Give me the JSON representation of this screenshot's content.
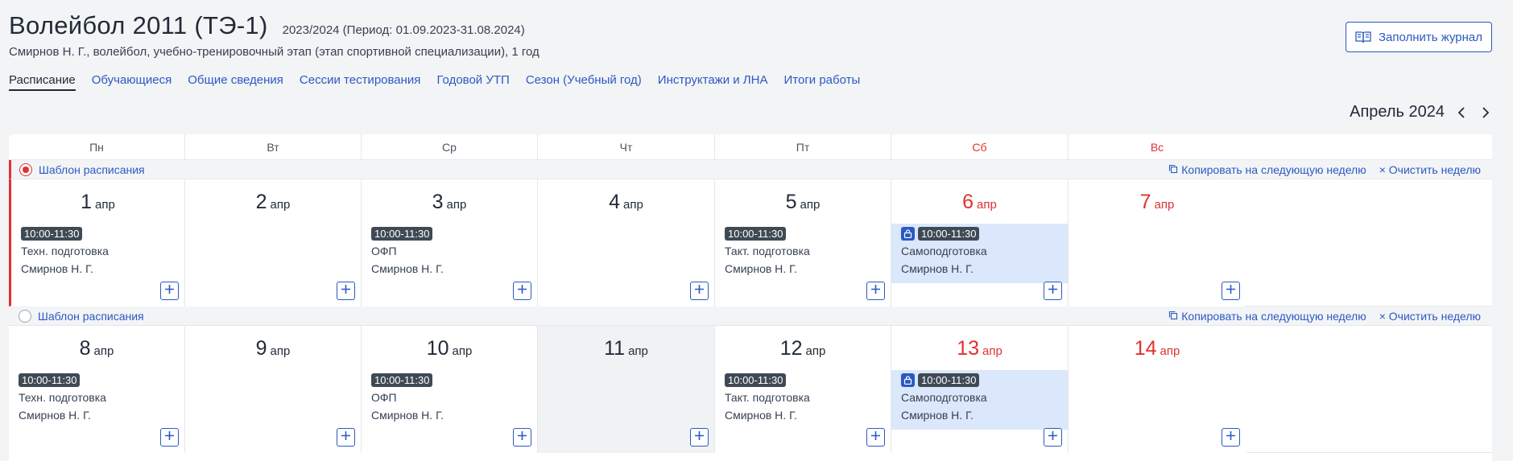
{
  "header": {
    "title": "Волейбол 2011 (ТЭ-1)",
    "period": "2023/2024 (Период: 01.09.2023-31.08.2024)",
    "subtitle": "Смирнов Н. Г., волейбол, учебно-тренировочный этап (этап спортивной специализации), 1 год",
    "fill_button": "Заполнить журнал"
  },
  "tabs": [
    {
      "label": "Расписание",
      "active": true
    },
    {
      "label": "Обучающиеся"
    },
    {
      "label": "Общие сведения"
    },
    {
      "label": "Сессии тестирования"
    },
    {
      "label": "Годовой УТП"
    },
    {
      "label": "Сезон (Учебный год)"
    },
    {
      "label": "Инструктажи и ЛНА"
    },
    {
      "label": "Итоги работы"
    }
  ],
  "calendar": {
    "month": "Апрель 2024",
    "weekdays": [
      "Пн",
      "Вт",
      "Ср",
      "Чт",
      "Пт",
      "Сб",
      "Вс"
    ],
    "weeks": [
      {
        "template_label": "Шаблон расписания",
        "selected": true,
        "copy_label": "Копировать на следующую неделю",
        "clear_label": "× Очистить неделю",
        "days": [
          {
            "num": "1",
            "month": "апр",
            "event": {
              "time": "10:00-11:30",
              "title": "Техн. подготовка",
              "coach": "Смирнов Н. Г."
            }
          },
          {
            "num": "2",
            "month": "апр"
          },
          {
            "num": "3",
            "month": "апр",
            "event": {
              "time": "10:00-11:30",
              "title": "ОФП",
              "coach": "Смирнов Н. Г."
            }
          },
          {
            "num": "4",
            "month": "апр"
          },
          {
            "num": "5",
            "month": "апр",
            "event": {
              "time": "10:00-11:30",
              "title": "Такт. подготовка",
              "coach": "Смирнов Н. Г."
            }
          },
          {
            "num": "6",
            "month": "апр",
            "event": {
              "time": "10:00-11:30",
              "title": "Самоподготовка",
              "coach": "Смирнов Н. Г.",
              "self": true
            }
          },
          {
            "num": "7",
            "month": "апр"
          }
        ]
      },
      {
        "template_label": "Шаблон расписания",
        "selected": false,
        "copy_label": "Копировать на следующую неделю",
        "clear_label": "× Очистить неделю",
        "days": [
          {
            "num": "8",
            "month": "апр",
            "event": {
              "time": "10:00-11:30",
              "title": "Техн. подготовка",
              "coach": "Смирнов Н. Г."
            }
          },
          {
            "num": "9",
            "month": "апр"
          },
          {
            "num": "10",
            "month": "апр",
            "event": {
              "time": "10:00-11:30",
              "title": "ОФП",
              "coach": "Смирнов Н. Г."
            }
          },
          {
            "num": "11",
            "month": "апр",
            "today": true
          },
          {
            "num": "12",
            "month": "апр",
            "event": {
              "time": "10:00-11:30",
              "title": "Такт. подготовка",
              "coach": "Смирнов Н. Г."
            }
          },
          {
            "num": "13",
            "month": "апр",
            "event": {
              "time": "10:00-11:30",
              "title": "Самоподготовка",
              "coach": "Смирнов Н. Г.",
              "self": true
            }
          },
          {
            "num": "14",
            "month": "апр"
          }
        ]
      }
    ]
  },
  "colors": {
    "accent": "#2b59c3",
    "weekend": "#e03131",
    "self_event_bg": "#dbe7fb",
    "time_badge": "#3f4a55"
  }
}
